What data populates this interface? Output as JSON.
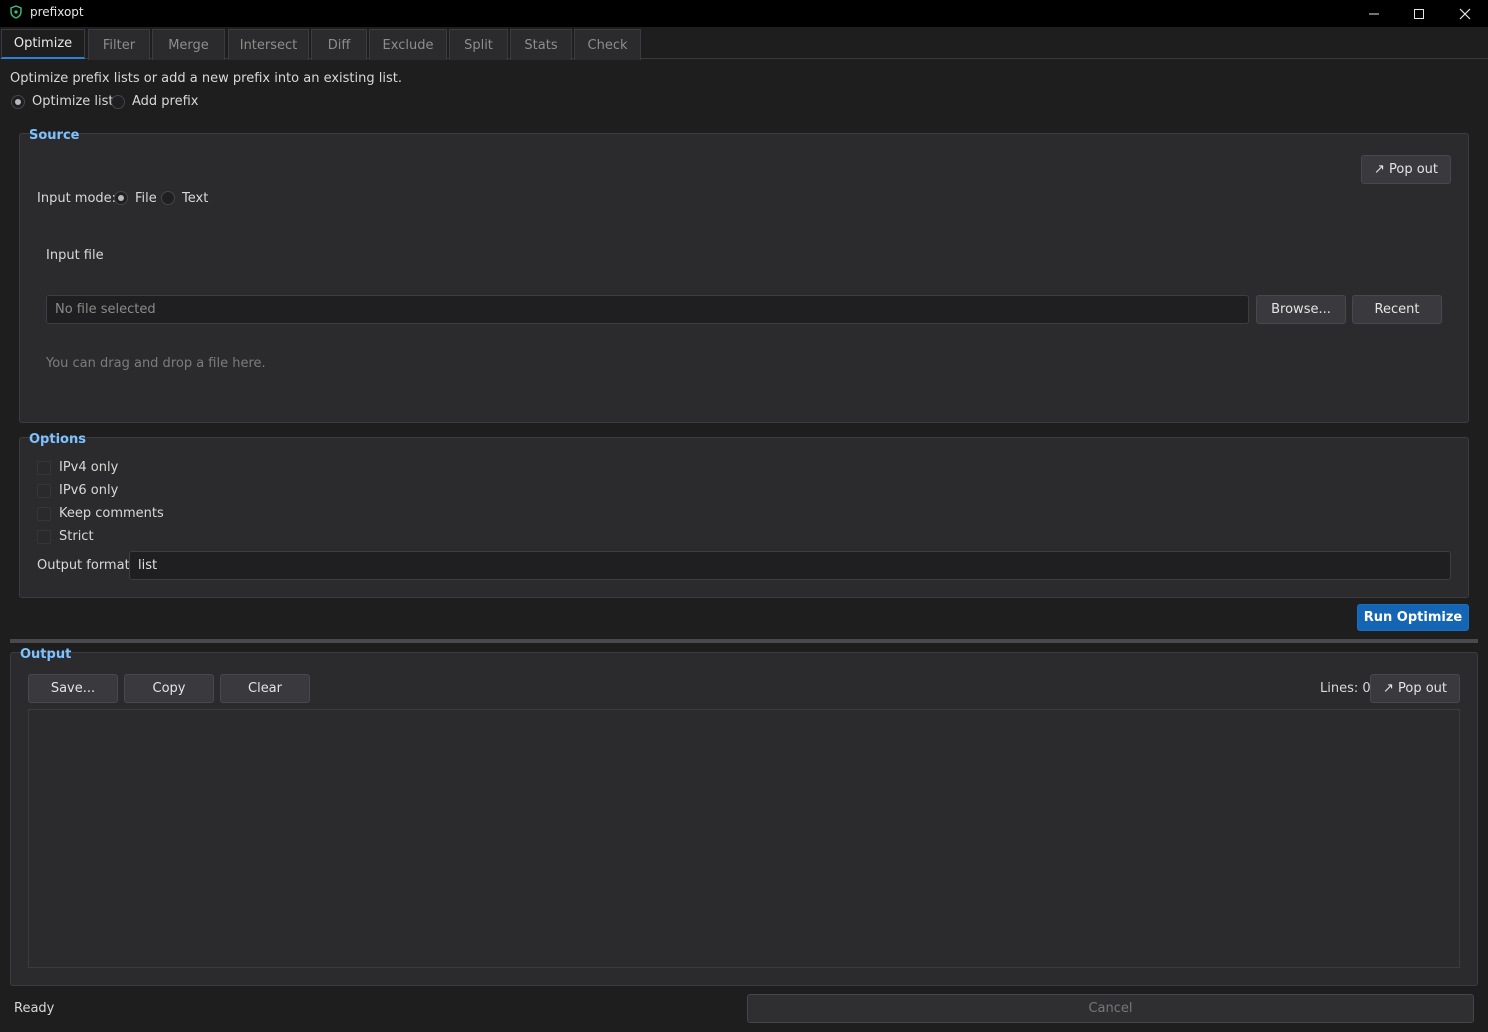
{
  "window": {
    "title": "prefixopt"
  },
  "tabs": [
    "Optimize",
    "Filter",
    "Merge",
    "Intersect",
    "Diff",
    "Exclude",
    "Split",
    "Stats",
    "Check"
  ],
  "description": "Optimize prefix lists or add a new prefix into an existing list.",
  "mode": {
    "optimize_label": "Optimize list",
    "add_label": "Add prefix",
    "selected": "Optimize list"
  },
  "source": {
    "title": "Source",
    "popout_label": "↗ Pop out",
    "input_mode_label": "Input mode:",
    "file_label": "File",
    "text_label": "Text",
    "input_file_label": "Input file",
    "file_placeholder": "No file selected",
    "browse_label": "Browse...",
    "recent_label": "Recent",
    "drag_hint": "You can drag and drop a file here."
  },
  "options": {
    "title": "Options",
    "ipv4_label": "IPv4 only",
    "ipv6_label": "IPv6 only",
    "keep_comments_label": "Keep comments",
    "strict_label": "Strict",
    "output_format_label": "Output format:",
    "output_format_value": "list"
  },
  "run_label": "Run Optimize",
  "output": {
    "title": "Output",
    "save_label": "Save...",
    "copy_label": "Copy",
    "clear_label": "Clear",
    "lines_label": "Lines: 0",
    "popout_label": "↗ Pop out"
  },
  "status": {
    "text": "Ready",
    "cancel_label": "Cancel"
  },
  "colors": {
    "accent": "#2f7fd6",
    "group_title": "#7ec1ff",
    "primary_button": "#1565b5"
  }
}
